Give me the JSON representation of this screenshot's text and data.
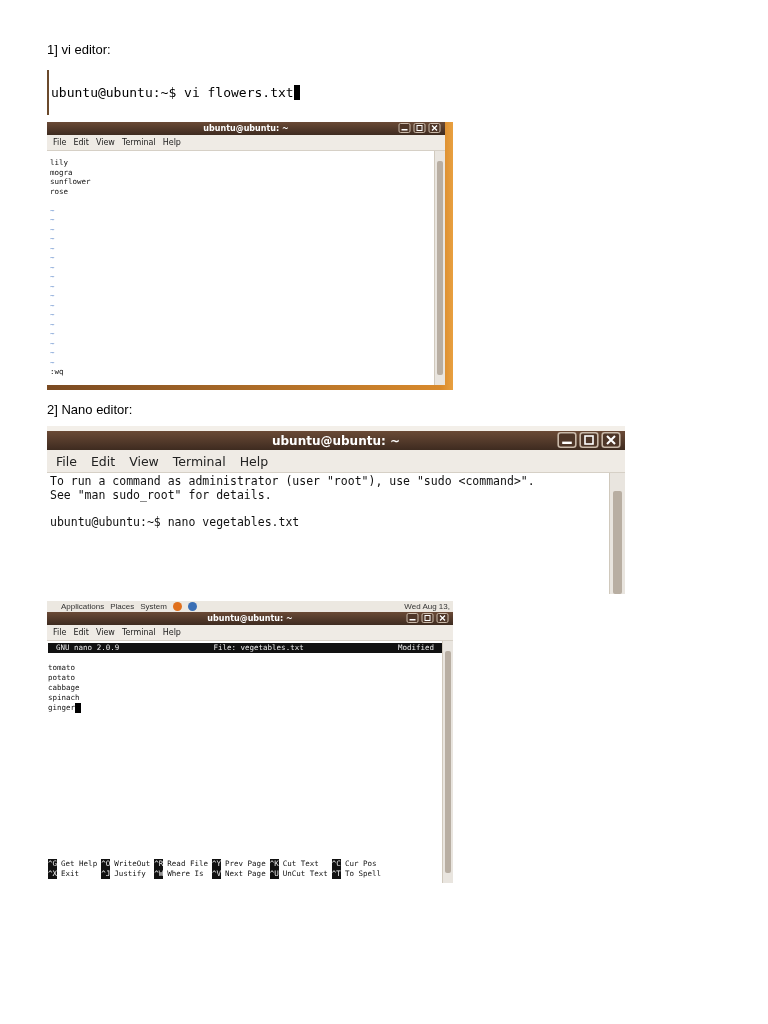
{
  "heading_vi": "1] vi editor:",
  "vi_prompt": {
    "text": "ubuntu@ubuntu:~$ vi flowers.txt",
    "cursor": true
  },
  "vi_window": {
    "title": "ubuntu@ubuntu: ~",
    "menu": [
      "File",
      "Edit",
      "View",
      "Terminal",
      "Help"
    ],
    "text_lines": [
      "lily",
      "mogra",
      "sunflower",
      "rose"
    ],
    "tilde_lines": [
      "~",
      "~",
      "~",
      "~",
      "~",
      "~",
      "~",
      "~",
      "~",
      "~",
      "~",
      "~",
      "~",
      "~",
      "~",
      "~",
      "~"
    ],
    "command_line": ":wq"
  },
  "heading_nano": "2] Nano editor:",
  "nano_terminal": {
    "title": "ubuntu@ubuntu: ~",
    "menu": [
      "File",
      "Edit",
      "View",
      "Terminal",
      "Help"
    ],
    "lines": [
      "To run a command as administrator (user \"root\"), use \"sudo <command>\".",
      "See \"man sudo_root\" for details."
    ],
    "prompt": "ubuntu@ubuntu:~$ nano vegetables.txt"
  },
  "nano_window": {
    "panel": {
      "menus": [
        "Applications",
        "Places",
        "System"
      ],
      "clock": "Wed Aug 13,"
    },
    "title": "ubuntu@ubuntu: ~",
    "menu": [
      "File",
      "Edit",
      "View",
      "Terminal",
      "Help"
    ],
    "header": {
      "version": "GNU nano 2.0.9",
      "file": "File: vegetables.txt",
      "status": "Modified"
    },
    "lines": [
      "tomato",
      "potato",
      "cabbage",
      "spinach",
      "ginger"
    ],
    "cursor": true,
    "shortcuts": [
      {
        "key": "^G",
        "label": "Get Help"
      },
      {
        "key": "^O",
        "label": "WriteOut"
      },
      {
        "key": "^R",
        "label": "Read File"
      },
      {
        "key": "^Y",
        "label": "Prev Page"
      },
      {
        "key": "^K",
        "label": "Cut Text"
      },
      {
        "key": "^C",
        "label": "Cur Pos"
      },
      {
        "key": "^X",
        "label": "Exit"
      },
      {
        "key": "^J",
        "label": "Justify"
      },
      {
        "key": "^W",
        "label": "Where Is"
      },
      {
        "key": "^V",
        "label": "Next Page"
      },
      {
        "key": "^U",
        "label": "UnCut Text"
      },
      {
        "key": "^T",
        "label": "To Spell"
      }
    ]
  }
}
